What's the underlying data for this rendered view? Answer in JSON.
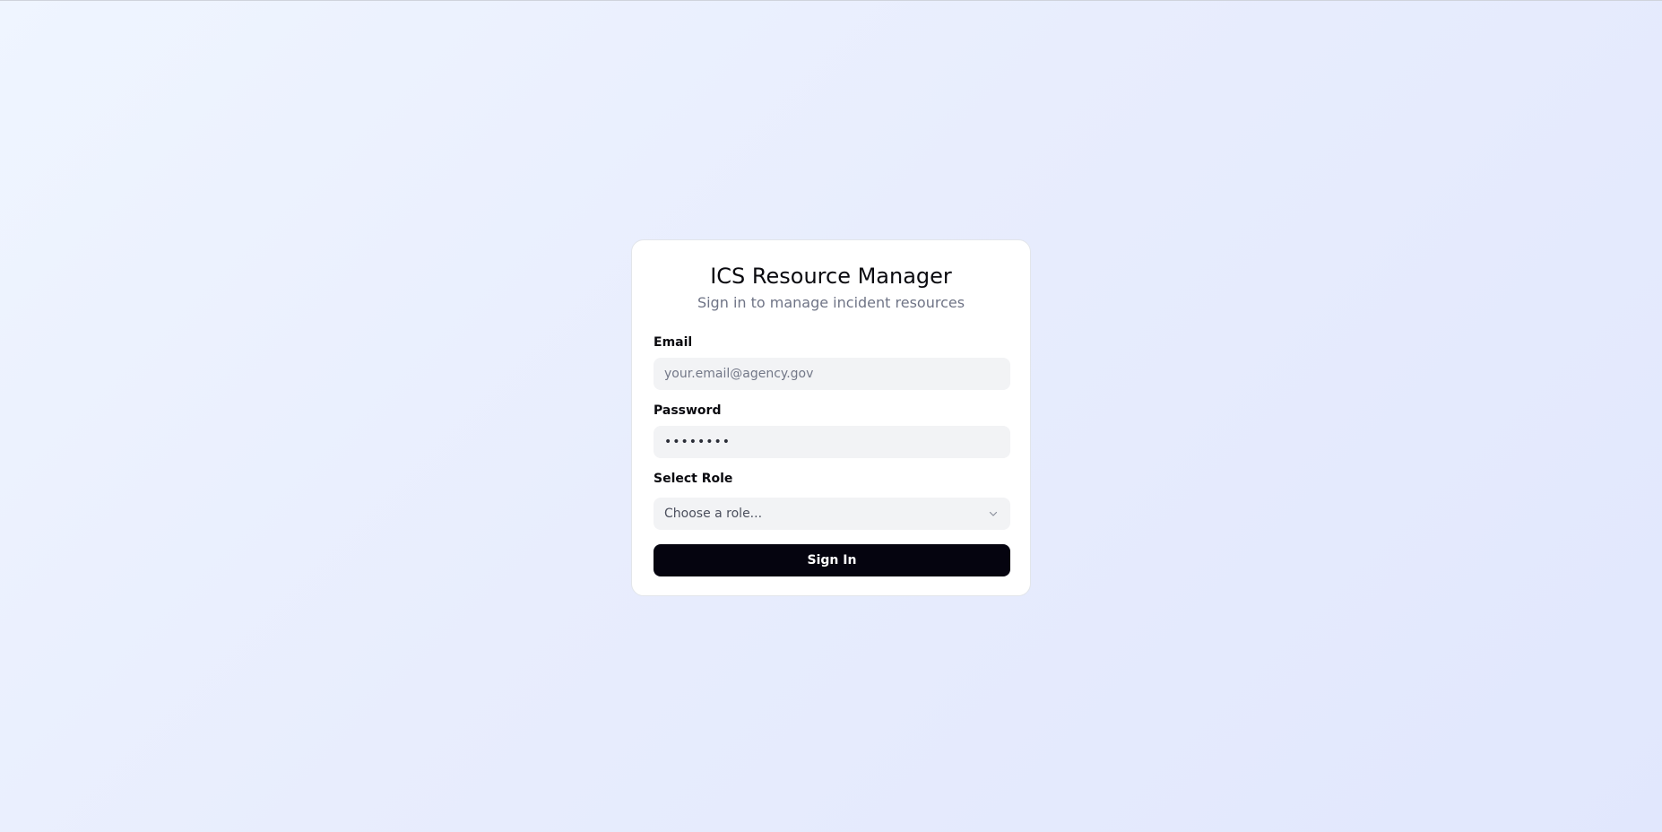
{
  "app": {
    "title": "ICS Resource Manager",
    "subtitle": "Sign in to manage incident resources"
  },
  "form": {
    "email": {
      "label": "Email",
      "placeholder": "your.email@agency.gov",
      "value": ""
    },
    "password": {
      "label": "Password",
      "value": "password"
    },
    "role": {
      "label": "Select Role",
      "selected": "Choose a role...",
      "icon": "chevron-down-icon"
    },
    "submit_label": "Sign In"
  },
  "colors": {
    "primary_button": "#05040f",
    "input_background": "#f2f3f5",
    "card_background": "#ffffff",
    "muted_text": "#6f7486"
  }
}
